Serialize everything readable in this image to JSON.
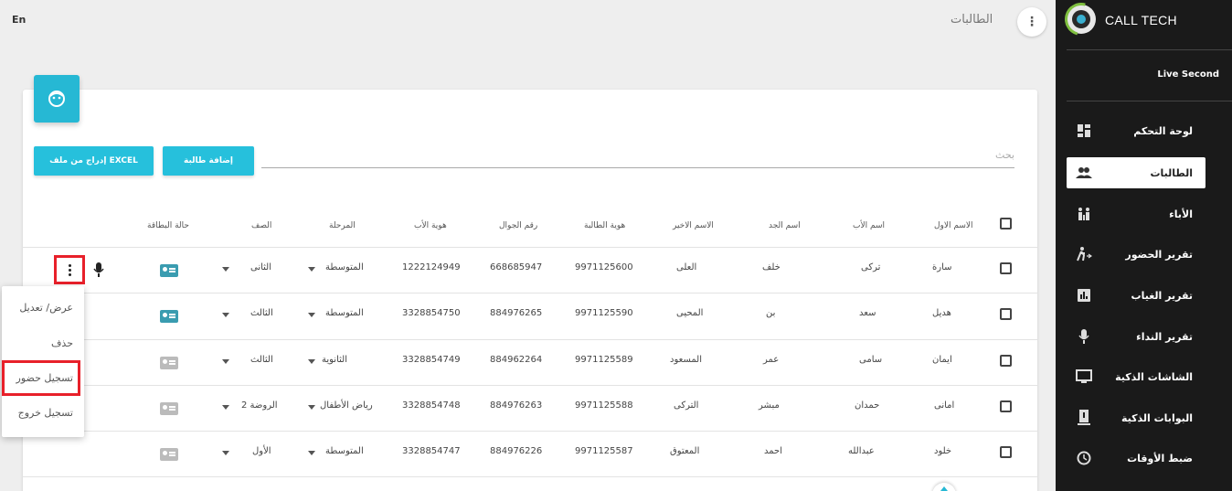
{
  "header": {
    "title": "الطالبات",
    "lang_toggle": "En"
  },
  "sidebar": {
    "brand": "CALL TECH",
    "live": "Live Second",
    "items": [
      {
        "label": "لوحة التحكم",
        "icon": "dashboard-icon"
      },
      {
        "label": "الطالبات",
        "icon": "people-icon",
        "active": true
      },
      {
        "label": "الأباء",
        "icon": "family-icon"
      },
      {
        "label": "تقرير الحضور",
        "icon": "walking-icon"
      },
      {
        "label": "تقرير الغياب",
        "icon": "bar-chart-icon"
      },
      {
        "label": "تقرير النداء",
        "icon": "microphone-icon"
      },
      {
        "label": "الشاشات الذكية",
        "icon": "monitor-icon"
      },
      {
        "label": "البوابات الذكية",
        "icon": "gate-icon"
      },
      {
        "label": "ضبط الأوقات",
        "icon": "clock-icon"
      }
    ]
  },
  "toolbar": {
    "add_label": "إضافة طالبة",
    "excel_label": "إدراج من ملف EXCEL",
    "search_placeholder": "بحث"
  },
  "table": {
    "columns": [
      "الاسم الاول",
      "اسم الأب",
      "اسم الجد",
      "الاسم الاخير",
      "هوية الطالبة",
      "رقم الجوال",
      "هوية الأب",
      "المرحلة",
      "الصف",
      "حالة البطاقة"
    ],
    "rows": [
      {
        "first": "سارة",
        "father": "تركى",
        "grand": "خلف",
        "last": "العلى",
        "student_id": "9971125600",
        "mobile": "668685947",
        "father_id": "1222124949",
        "stage": "المتوسطة",
        "grade": "الثانى",
        "card_active": true
      },
      {
        "first": "هديل",
        "father": "سعد",
        "grand": "بن",
        "last": "المحيى",
        "student_id": "9971125590",
        "mobile": "884976265",
        "father_id": "3328854750",
        "stage": "المتوسطة",
        "grade": "الثالث",
        "card_active": true
      },
      {
        "first": "ايمان",
        "father": "سامى",
        "grand": "عمر",
        "last": "المسعود",
        "student_id": "9971125589",
        "mobile": "884962264",
        "father_id": "3328854749",
        "stage": "الثانوية",
        "grade": "الثالث",
        "card_active": false
      },
      {
        "first": "امانى",
        "father": "حمدان",
        "grand": "مبشر",
        "last": "التركى",
        "student_id": "9971125588",
        "mobile": "884976263",
        "father_id": "3328854748",
        "stage": "رياض الأطفال",
        "grade": "الروضة 2",
        "card_active": false
      },
      {
        "first": "خلود",
        "father": "عبدالله",
        "grand": "احمد",
        "last": "المعتوق",
        "student_id": "9971125587",
        "mobile": "884976226",
        "father_id": "3328854747",
        "stage": "المتوسطة",
        "grade": "الأول",
        "card_active": false
      }
    ]
  },
  "row_menu": {
    "items": [
      "عرض/ تعديل",
      "حذف",
      "تسجيل حضور",
      "تسجيل خروج"
    ]
  },
  "colors": {
    "accent": "#26c0dc",
    "sidebar_bg": "#1a1a1a",
    "highlight": "#e8202a"
  }
}
